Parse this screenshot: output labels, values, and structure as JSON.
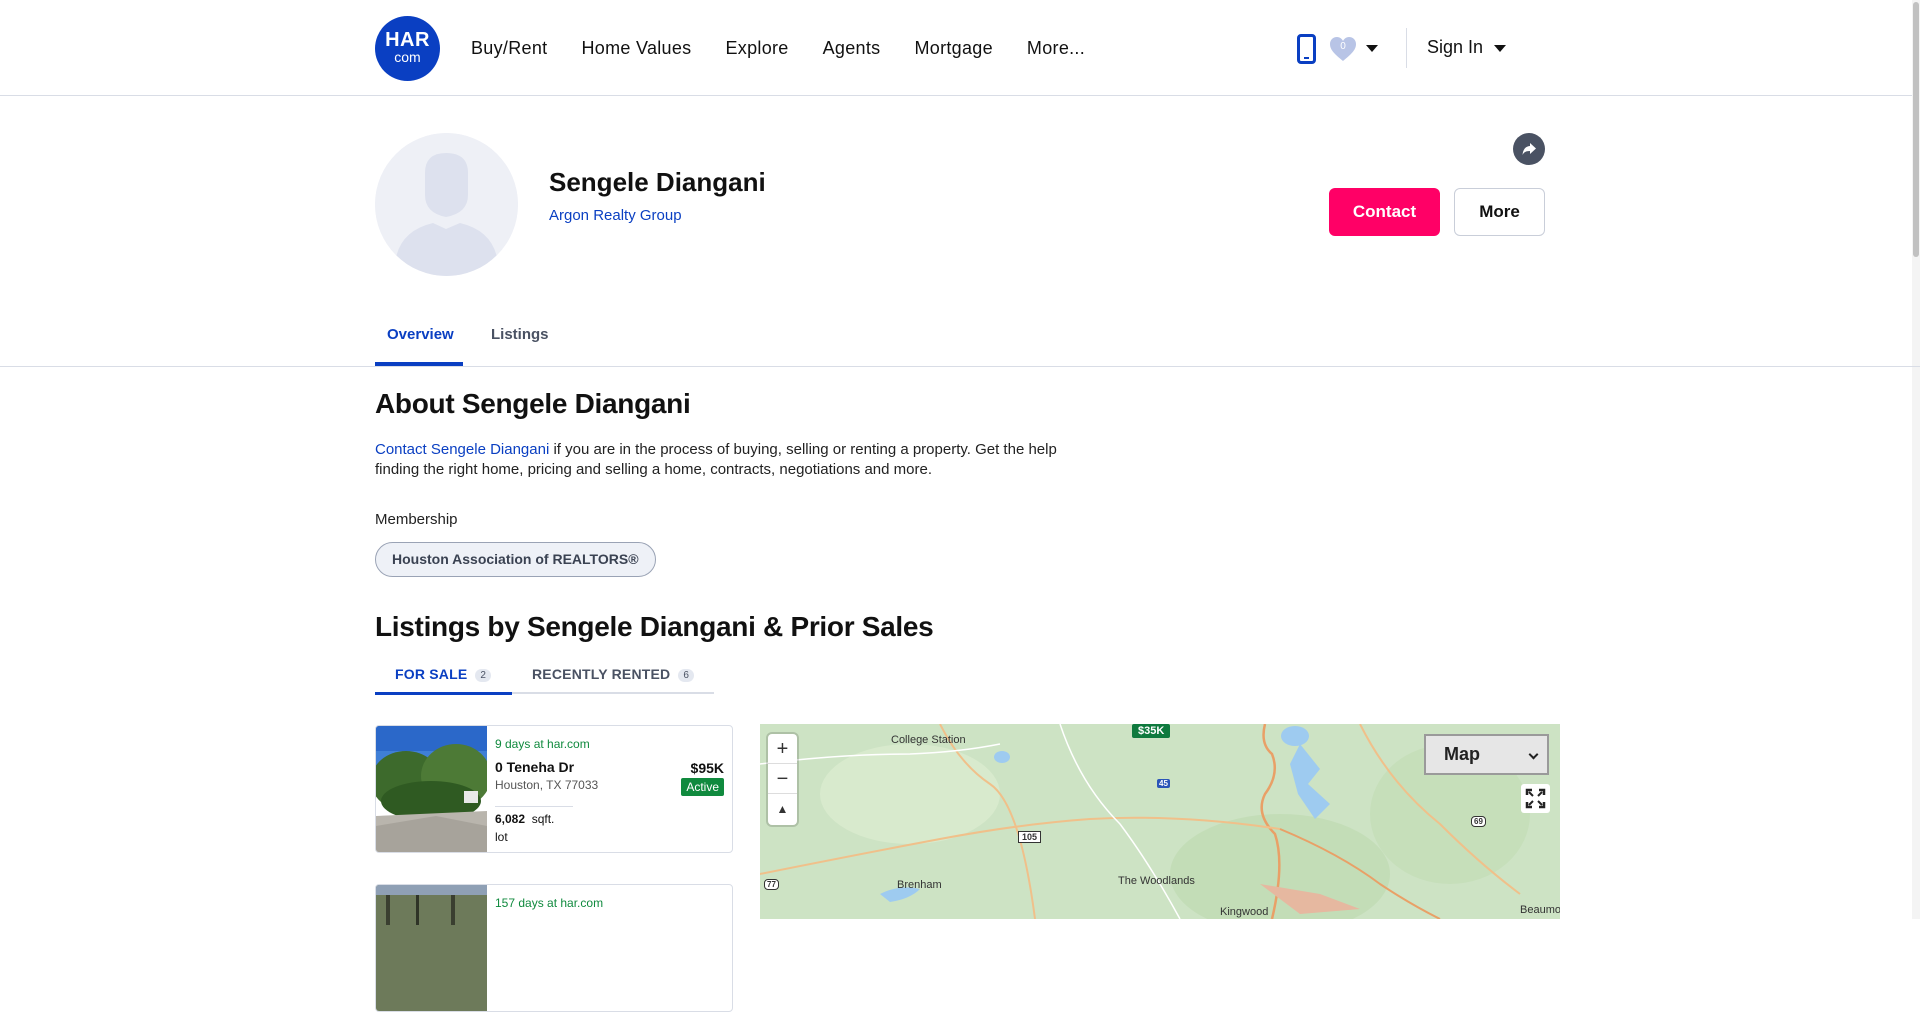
{
  "header": {
    "logo_top": "HAR",
    "logo_bottom": "com",
    "nav": [
      "Buy/Rent",
      "Home Values",
      "Explore",
      "Agents",
      "Mortgage",
      "More..."
    ],
    "favorites_count": "0",
    "sign_in": "Sign In"
  },
  "profile": {
    "name": "Sengele Diangani",
    "company": "Argon Realty Group",
    "contact_label": "Contact",
    "more_label": "More"
  },
  "tabs": [
    "Overview",
    "Listings"
  ],
  "about": {
    "title": "About Sengele Diangani",
    "link_text": "Contact Sengele Diangani",
    "body_text": " if you are in the process of buying, selling or renting a property. Get the help finding the right home, pricing and selling a home, contracts, negotiations and more.",
    "membership_label": "Membership",
    "membership_value": "Houston Association of REALTORS®"
  },
  "listings": {
    "title": "Listings by Sengele Diangani & Prior Sales",
    "tabs": [
      {
        "label": "FOR SALE",
        "count": "2"
      },
      {
        "label": "RECENTLY RENTED",
        "count": "6"
      }
    ],
    "cards": [
      {
        "days": "9 days at har.com",
        "address": "0 Teneha Dr",
        "city": "Houston, TX 77033",
        "price": "$95K",
        "status": "Active",
        "lot_size": "6,082",
        "lot_unit": "sqft.",
        "lot_label": "lot"
      },
      {
        "days": "157 days at har.com"
      }
    ]
  },
  "map": {
    "type_select": "Map",
    "price_marker": "$35K",
    "labels": [
      "College Station",
      "Brenham",
      "The Woodlands",
      "Beaumo",
      "Kingwood"
    ],
    "shields": [
      "105",
      "45",
      "69",
      "77"
    ]
  },
  "colors": {
    "brand_blue": "#0a3fc2",
    "contact_pink": "#ff0066",
    "active_green": "#108a3e"
  }
}
